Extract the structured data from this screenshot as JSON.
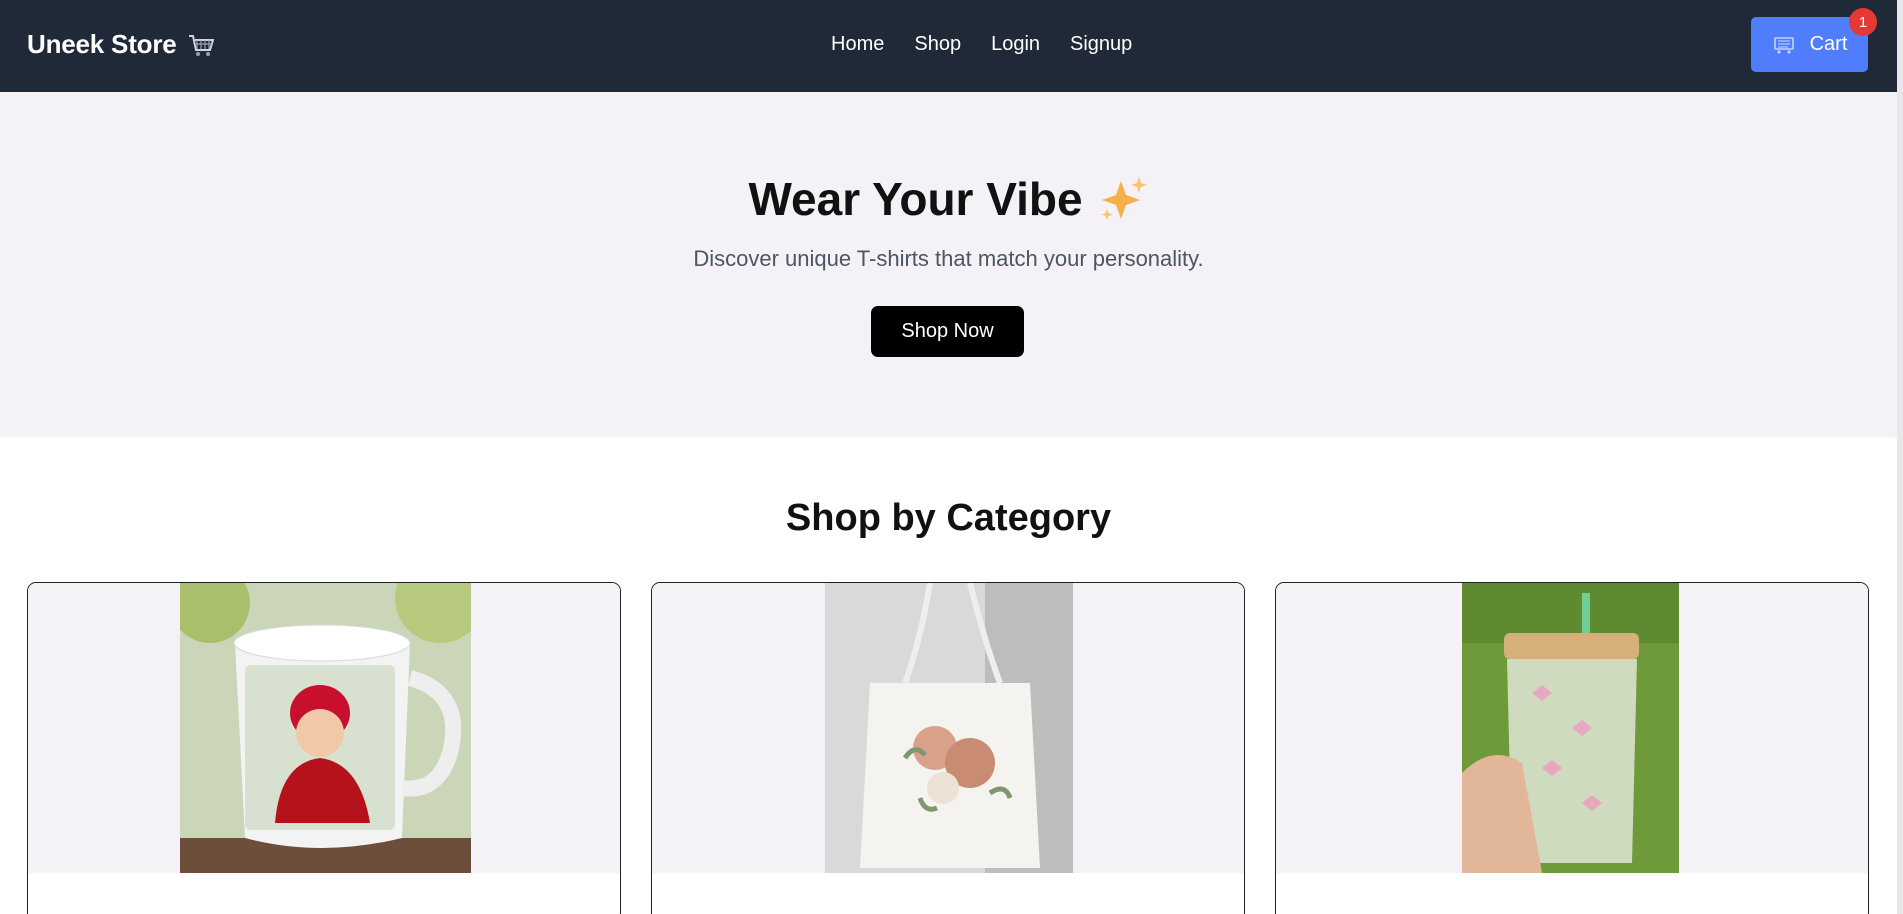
{
  "brand": {
    "name": "Uneek Store",
    "icon": "shopping-cart-icon"
  },
  "nav": {
    "links": [
      "Home",
      "Shop",
      "Login",
      "Signup"
    ]
  },
  "cart": {
    "label": "Cart",
    "count": "1",
    "icon": "cart-icon"
  },
  "hero": {
    "title": "Wear Your Vibe",
    "subtitle": "Discover unique T-shirts that match your personality.",
    "cta": "Shop Now",
    "icon": "sparkles-icon"
  },
  "categories": {
    "title": "Shop by Category",
    "items": [
      {
        "image": "baby-photo-mug"
      },
      {
        "image": "floral-tote-bag"
      },
      {
        "image": "glass-tumbler-with-bows"
      }
    ]
  },
  "colors": {
    "navbar": "#1f2937",
    "accent": "#4f7dfb",
    "badge": "#e53935",
    "hero_bg": "#f4f2f6"
  }
}
